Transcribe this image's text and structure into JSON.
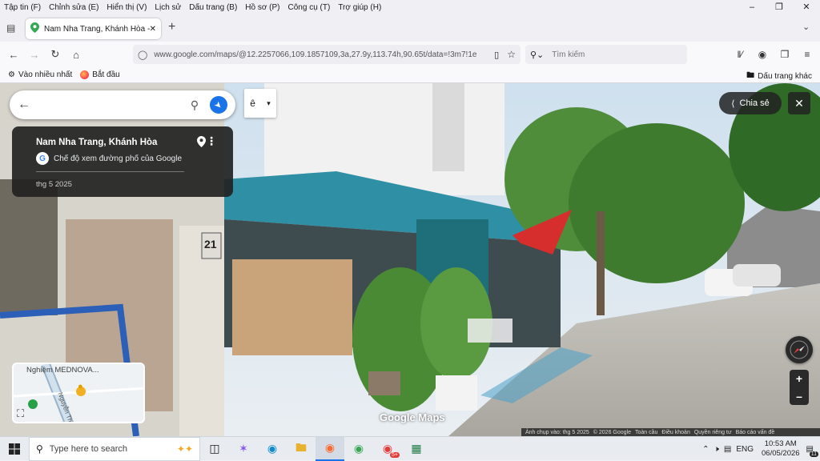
{
  "menubar": {
    "items": [
      "Tập tin (F)",
      "Chỉnh sửa (E)",
      "Hiển thị (V)",
      "Lịch sử",
      "Dấu trang (B)",
      "Hồ sơ (P)",
      "Công cụ (T)",
      "Trợ giúp (H)"
    ]
  },
  "tabs": [
    {
      "title": "Nam Nha Trang, Khánh Hòa - G"
    }
  ],
  "navbar": {
    "url": "www.google.com/maps/@12.2257066,109.1857109,3a,27.9y,113.74h,90.65t/data=!3m7!1e",
    "search_placeholder": "Tìm kiếm"
  },
  "bookmarks": {
    "items": [
      {
        "label": "Vào nhiều nhất",
        "icon": "gear-icon"
      },
      {
        "label": "Bắt đầu",
        "icon": "firefox-icon"
      }
    ],
    "other": "Dấu trang khác"
  },
  "maps": {
    "search_value": "",
    "ime_letter": "ê",
    "place_name": "Nam Nha Trang, Khánh Hòa",
    "mode_label": "Chế độ xem đường phố của Google",
    "capture_date": "thg 5 2025",
    "share_label": "Chia sẻ",
    "minimap_label": "Nghiệm MEDNOVA...",
    "minimap_street": "Nguyễn Thị Đ",
    "logo_text": "Google Maps",
    "house_number": "21",
    "footer": [
      "Ảnh chụp vào: thg 5 2025",
      "© 2026 Google",
      "Toàn cầu",
      "Điều khoản",
      "Quyền riêng tư",
      "Báo cáo vấn đề"
    ]
  },
  "taskbar": {
    "search_placeholder": "Type here to search",
    "lang": "ENG",
    "time": "10:53 AM",
    "date": "06/05/2026",
    "notif_count": "11",
    "badge": "5+"
  }
}
